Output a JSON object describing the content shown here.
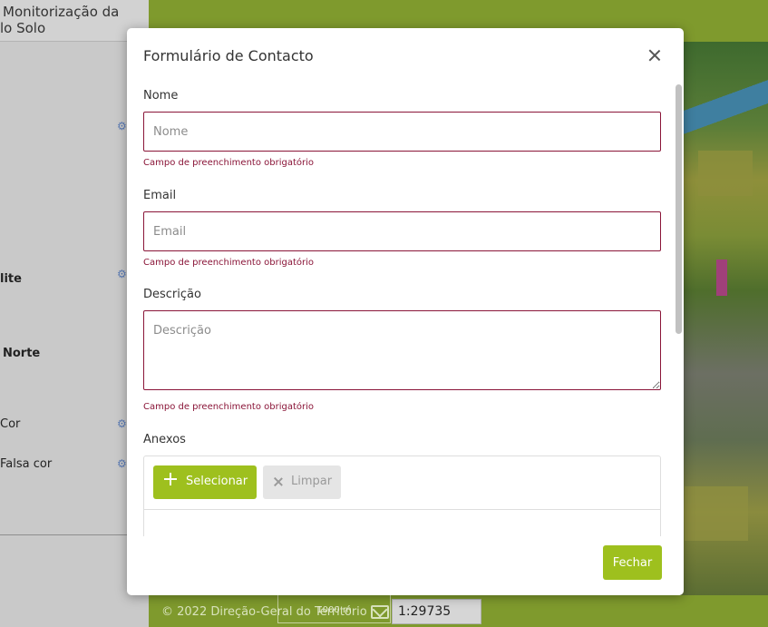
{
  "sidebar": {
    "header_line1": "Monitorização da",
    "header_line2": "lo Solo",
    "items": [
      {
        "label": "lite",
        "bold": true
      },
      {
        "label": "Norte",
        "bold": true
      },
      {
        "label": "Cor",
        "bold": false
      },
      {
        "label": "Falsa cor",
        "bold": false
      }
    ]
  },
  "footer": {
    "copyright": "© 2022 Direção-Geral do Território",
    "scale_label": "1000 m",
    "scale_value": "1:29735"
  },
  "modal": {
    "title": "Formulário de Contacto",
    "fields": {
      "name": {
        "label": "Nome",
        "placeholder": "Nome",
        "error": "Campo de preenchimento obrigatório"
      },
      "email": {
        "label": "Email",
        "placeholder": "Email",
        "error": "Campo de preenchimento obrigatório"
      },
      "description": {
        "label": "Descrição",
        "placeholder": "Descrição",
        "error": "Campo de preenchimento obrigatório"
      }
    },
    "attachments": {
      "label": "Anexos",
      "select_label": "Selecionar",
      "clear_label": "Limpar"
    },
    "close_label": "Fechar"
  },
  "colors": {
    "accent": "#9ec01e",
    "error": "#8a1538",
    "topbar": "#7f9a2d"
  },
  "icons": [
    "close-icon",
    "gear-icon",
    "plus-icon",
    "x-icon",
    "mail-icon"
  ]
}
